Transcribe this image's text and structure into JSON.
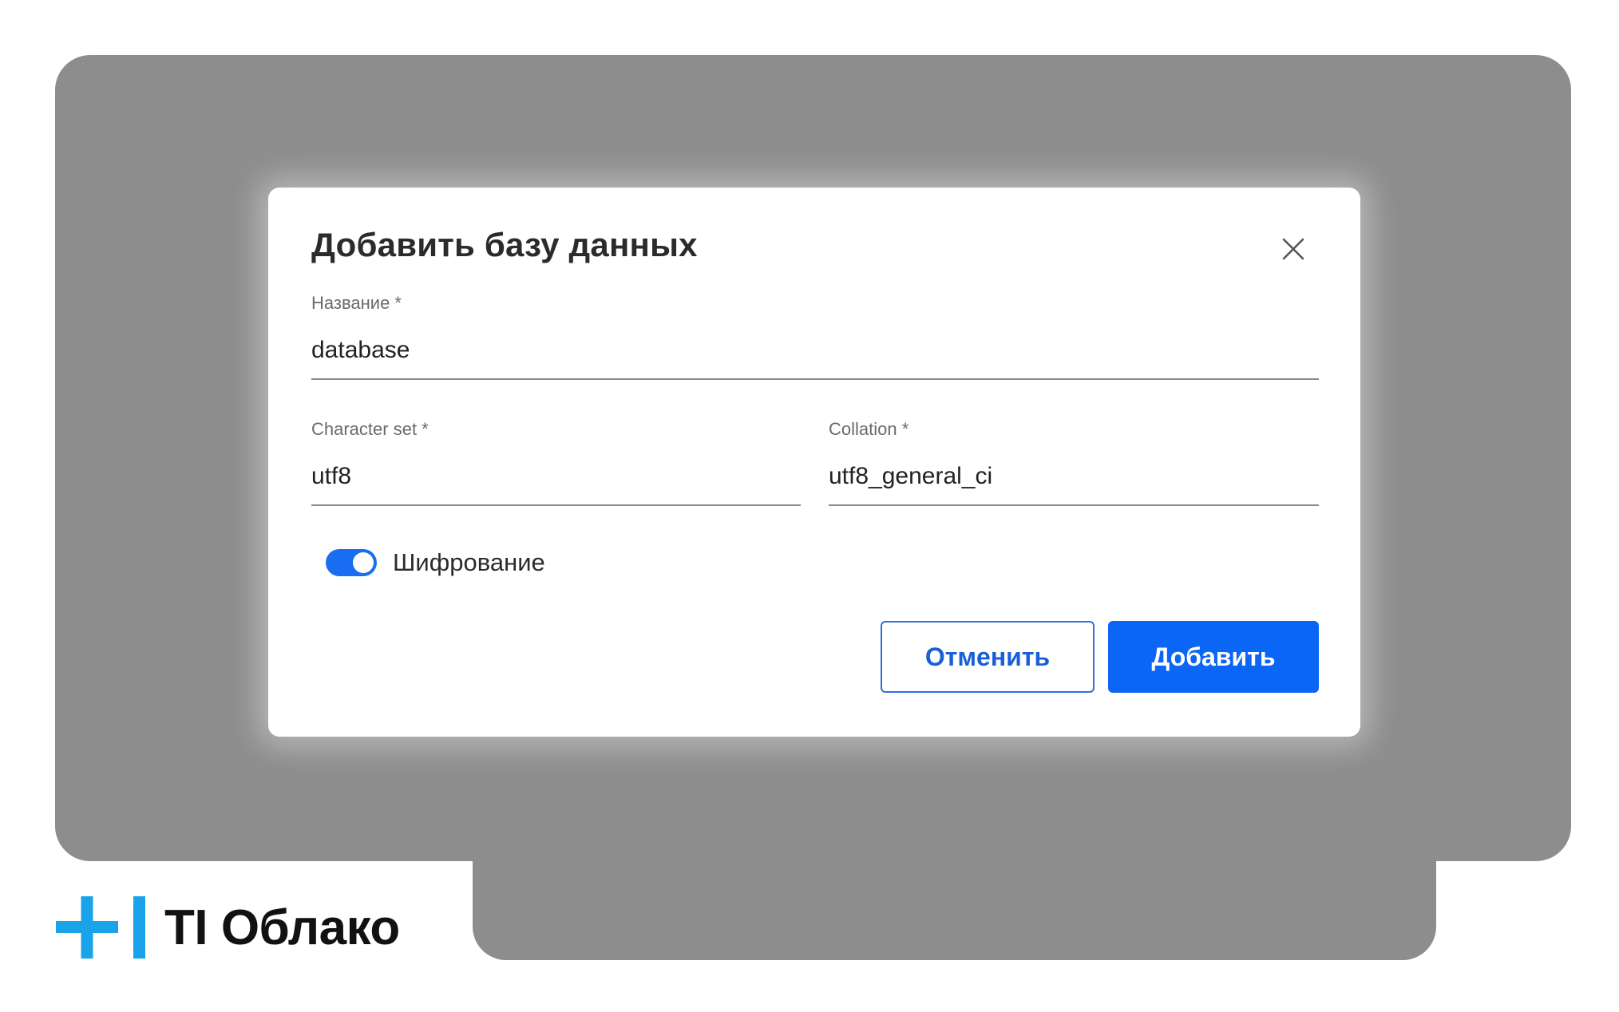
{
  "dialog": {
    "title": "Добавить базу данных",
    "fields": {
      "name": {
        "label": "Название *",
        "value": "database"
      },
      "charset": {
        "label": "Character set *",
        "value": "utf8"
      },
      "collation": {
        "label": "Collation *",
        "value": "utf8_general_ci"
      }
    },
    "encryption": {
      "label": "Шифрование",
      "enabled": true
    },
    "buttons": {
      "cancel": "Отменить",
      "add": "Добавить"
    },
    "icons": {
      "close": "close-icon"
    }
  },
  "brand": {
    "name": "TI Облако",
    "logo": "plus-bar-logo"
  },
  "colors": {
    "accent": "#0b66f5",
    "brand_blue": "#1aa3e8",
    "backdrop": "#8d8d8d"
  }
}
